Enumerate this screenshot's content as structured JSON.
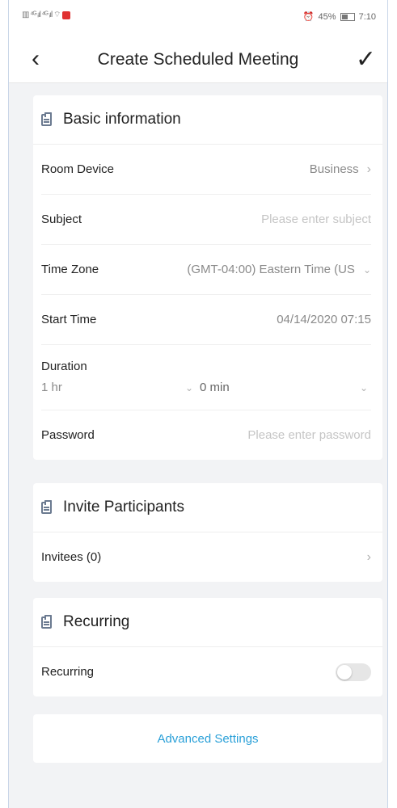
{
  "status_bar": {
    "left_text": "▥ ⁴ᴳ ᵢıl ⁴ᴳ ᵢıl ⌔",
    "alarm": "⏰",
    "battery_percent": "45%",
    "time": "7:10"
  },
  "navbar": {
    "title": "Create Scheduled Meeting"
  },
  "basic_info": {
    "header": "Basic information",
    "room_device_label": "Room Device",
    "room_device_value": "Business",
    "subject_label": "Subject",
    "subject_placeholder": "Please enter subject",
    "time_zone_label": "Time Zone",
    "time_zone_value": "(GMT-04:00) Eastern Time (US",
    "start_time_label": "Start Time",
    "start_time_value": "04/14/2020 07:15",
    "duration_label": "Duration",
    "duration_hours": "1 hr",
    "duration_minutes": "0 min",
    "password_label": "Password",
    "password_placeholder": "Please enter password"
  },
  "invite": {
    "header": "Invite Participants",
    "invitees_label": "Invitees (0)"
  },
  "recurring": {
    "header": "Recurring",
    "recurring_label": "Recurring"
  },
  "advanced_settings": "Advanced Settings",
  "colors": {
    "accent": "#2aa0d8",
    "background": "#f2f3f5"
  }
}
